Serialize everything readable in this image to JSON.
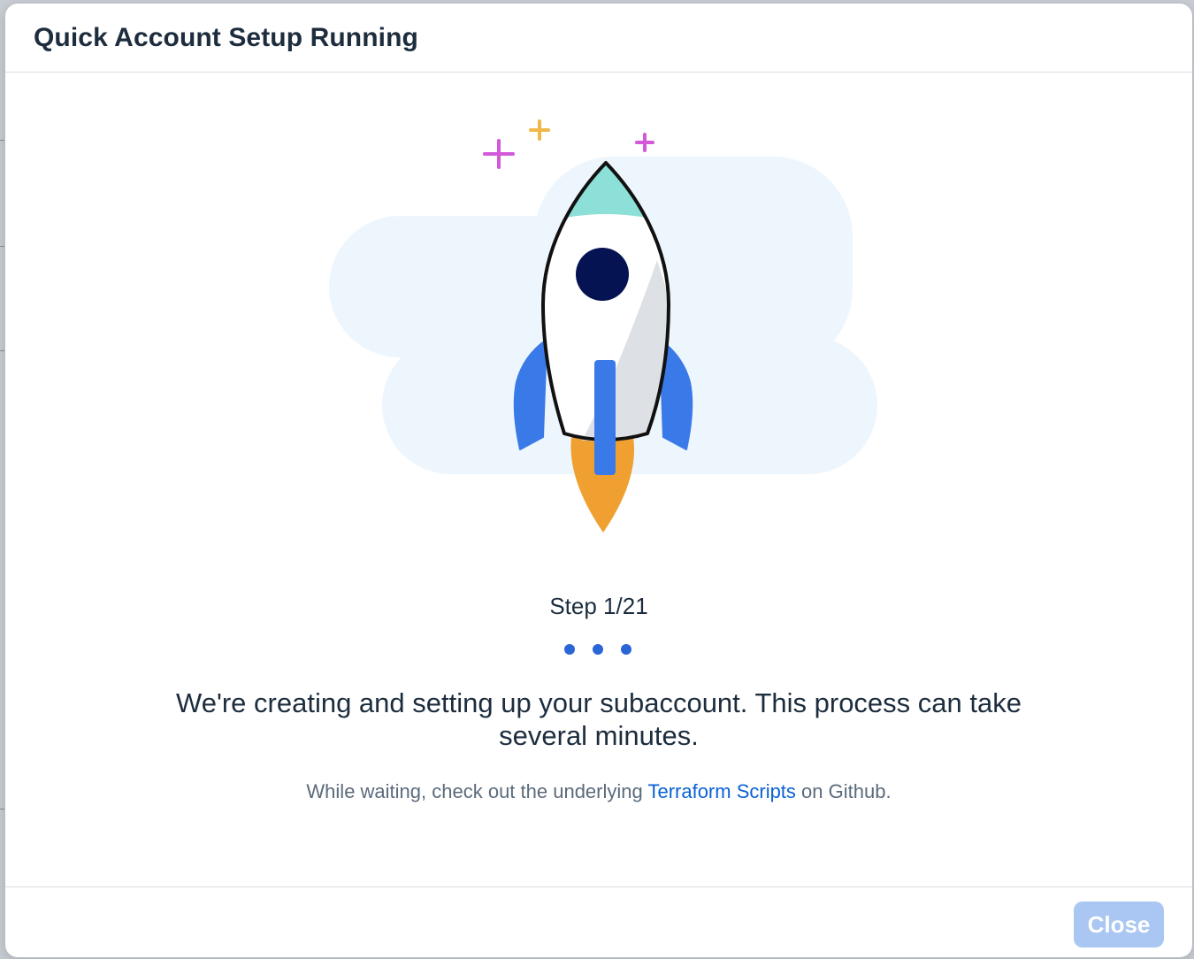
{
  "dialog": {
    "title": "Quick Account Setup Running"
  },
  "progress": {
    "step_label": "Step 1/21",
    "current_step": 1,
    "total_steps": 21
  },
  "message": {
    "main": "We're creating and setting up your subaccount. This process can take several minutes.",
    "hint_prefix": "While waiting, check out the underlying ",
    "hint_link": "Terraform Scripts",
    "hint_suffix": " on Github."
  },
  "footer": {
    "close_label": "Close",
    "close_enabled": false
  },
  "icons": {
    "illustration": "rocket-launch-illustration",
    "busy": "busy-indicator-dots"
  },
  "colors": {
    "title": "#1d2d3e",
    "link": "#0a62d6",
    "busy_dot": "#2a66d6",
    "close_button_disabled": "#a9c7f2",
    "rocket_fin": "#3a7ae8",
    "rocket_flame": "#f0a030",
    "rocket_window": "#061352",
    "rocket_nose": "#8de0d8",
    "cloud": "#eef6fd"
  }
}
